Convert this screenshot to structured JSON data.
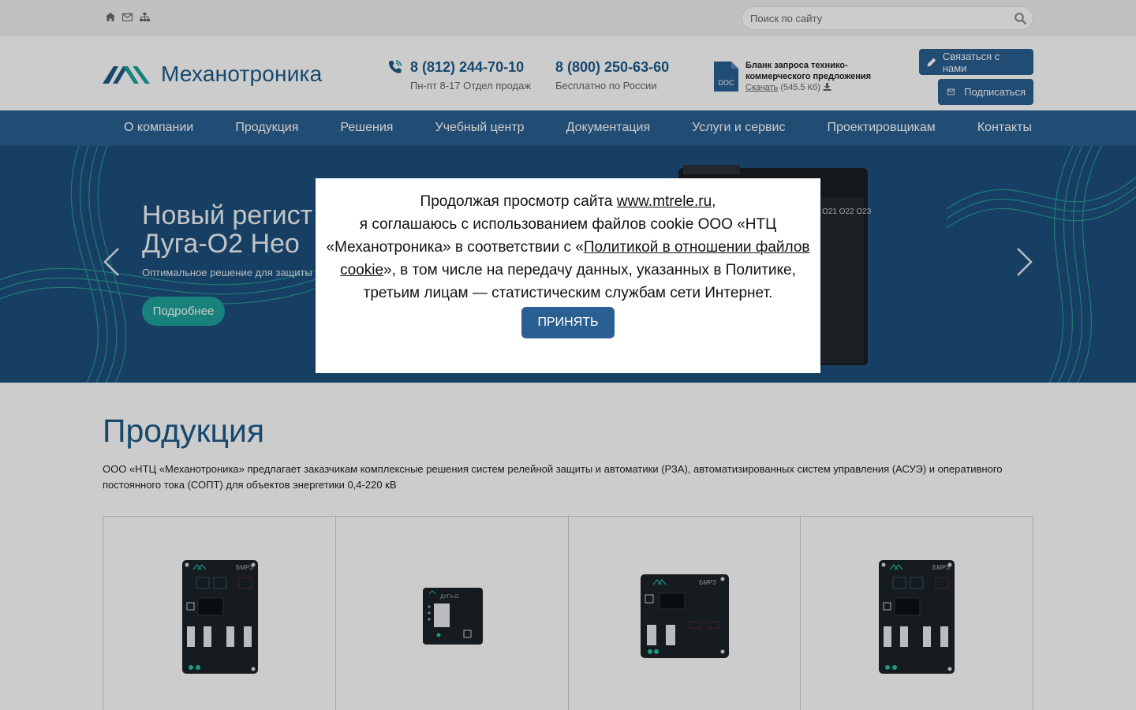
{
  "topbar": {
    "icons": [
      "home-icon",
      "mail-icon",
      "sitemap-icon"
    ],
    "search_placeholder": "Поиск по сайту"
  },
  "header": {
    "logo_text": "Механотроника",
    "phone1": {
      "number": "8 (812) 244-70-10",
      "caption": "Пн-пт 8-17 Отдел продаж"
    },
    "phone2": {
      "number": "8 (800) 250-63-60",
      "caption": "Бесплатно по России"
    },
    "doc": {
      "icon_label": "DOC",
      "title": "Бланк запроса технико-коммерческого предложения",
      "download_label": "Скачать",
      "size": "(545.5 Кб)"
    },
    "contact_button": "Связаться с нами",
    "subscribe_button": "Подписаться"
  },
  "nav": {
    "items": [
      "О компании",
      "Продукция",
      "Решения",
      "Учебный центр",
      "Документация",
      "Услуги и сервис",
      "Проектировщикам",
      "Контакты"
    ]
  },
  "hero": {
    "title_line1": "Новый регист",
    "title_line2": "Дуга-О2 Нео",
    "subtitle": "Оптимальное решение для защиты",
    "button": "Подробнее"
  },
  "products": {
    "title": "Продукция",
    "description": "ООО «НТЦ «Механотроника» предлагает заказчикам комплексные решения систем релейной защиты и автоматики (РЗА), автоматизированных систем управления (АСУЭ) и оперативного постоянного тока (СОПТ) для объектов энергетики 0,4-220 кВ",
    "device_labels": [
      "БМРЗ",
      "ДУГА-О",
      "БМРЗ",
      "БМРЗ"
    ]
  },
  "cookie_modal": {
    "text_before_site": "Продолжая просмотр сайта ",
    "site_link": "www.mtrele.ru",
    "text_after_site": ",",
    "line2": "я соглашаюсь с использованием файлов cookie ООО «НТЦ «Механотроника» в соответствии с «",
    "policy_link": "Политикой в отношении файлов cookie",
    "line3": "», в том числе на передачу данных, указанных в Политике, третьим лицам — статистическим службам сети Интернет.",
    "accept_button": "ПРИНЯТЬ"
  }
}
